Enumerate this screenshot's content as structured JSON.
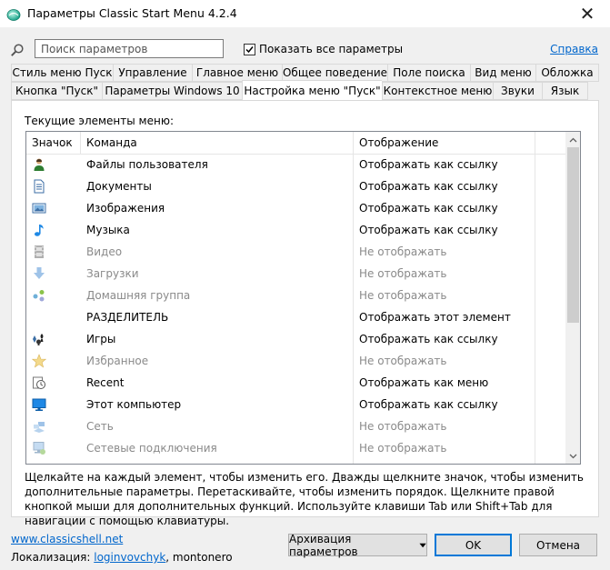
{
  "window": {
    "title": "Параметры Classic Start Menu 4.2.4",
    "close_glyph": "✕"
  },
  "search": {
    "placeholder": "Поиск параметров"
  },
  "show_all": {
    "label": "Показать все параметры",
    "checked": true
  },
  "help": {
    "label": "Справка"
  },
  "tabs_row1": [
    "Стиль меню Пуск",
    "Управление",
    "Главное меню",
    "Общее поведение",
    "Поле поиска",
    "Вид меню",
    "Обложка"
  ],
  "tabs_row2": [
    "Кнопка \"Пуск\"",
    "Параметры Windows 10",
    "Настройка меню \"Пуск\"",
    "Контекстное меню",
    "Звуки",
    "Язык"
  ],
  "active_tab": "Настройка меню \"Пуск\"",
  "section_label": "Текущие элементы меню:",
  "columns": [
    "Значок",
    "Команда",
    "Отображение"
  ],
  "rows": [
    {
      "icon": "user-files-icon",
      "command": "Файлы пользователя",
      "display": "Отображать как ссылку",
      "dim": false
    },
    {
      "icon": "documents-icon",
      "command": "Документы",
      "display": "Отображать как ссылку",
      "dim": false
    },
    {
      "icon": "pictures-icon",
      "command": "Изображения",
      "display": "Отображать как ссылку",
      "dim": false
    },
    {
      "icon": "music-note-icon",
      "command": "Музыка",
      "display": "Отображать как ссылку",
      "dim": false
    },
    {
      "icon": "video-film-icon",
      "command": "Видео",
      "display": "Не отображать",
      "dim": true
    },
    {
      "icon": "download-arrow-icon",
      "command": "Загрузки",
      "display": "Не отображать",
      "dim": true
    },
    {
      "icon": "homegroup-icon",
      "command": "Домашняя группа",
      "display": "Не отображать",
      "dim": true
    },
    {
      "icon": "",
      "command": "РАЗДЕЛИТЕЛЬ",
      "display": "Отображать этот элемент",
      "dim": false
    },
    {
      "icon": "games-icon",
      "command": "Игры",
      "display": "Отображать как ссылку",
      "dim": false
    },
    {
      "icon": "favorites-star-icon",
      "command": "Избранное",
      "display": "Не отображать",
      "dim": true
    },
    {
      "icon": "recent-clock-icon",
      "command": "Recent",
      "display": "Отображать как меню",
      "dim": false
    },
    {
      "icon": "computer-monitor-icon",
      "command": "Этот компьютер",
      "display": "Отображать как ссылку",
      "dim": false
    },
    {
      "icon": "network-icon",
      "command": "Сеть",
      "display": "Не отображать",
      "dim": true
    },
    {
      "icon": "network-connections-icon",
      "command": "Сетевые подключения",
      "display": "Не отображать",
      "dim": true
    }
  ],
  "hint": "Щелкайте на каждый элемент, чтобы изменить его. Дважды щелкните значок, чтобы изменить дополнительные параметры. Перетаскивайте, чтобы изменить порядок. Щелкните правой кнопкой мыши для дополнительных функций. Используйте клавиши Tab или Shift+Tab для навигации с помощью клавиатуры.",
  "footer": {
    "site_link": "www.classicshell.net",
    "localization_label": "Локализация:",
    "localization_link": "loginvovchyk",
    "localization_rest": ", montonero",
    "backup_button": "Архивация параметров",
    "ok_button": "OK",
    "cancel_button": "Отмена"
  },
  "colors": {
    "accent": "#0078d7",
    "link": "#0066cc",
    "dim_text": "#8a8a8a"
  }
}
